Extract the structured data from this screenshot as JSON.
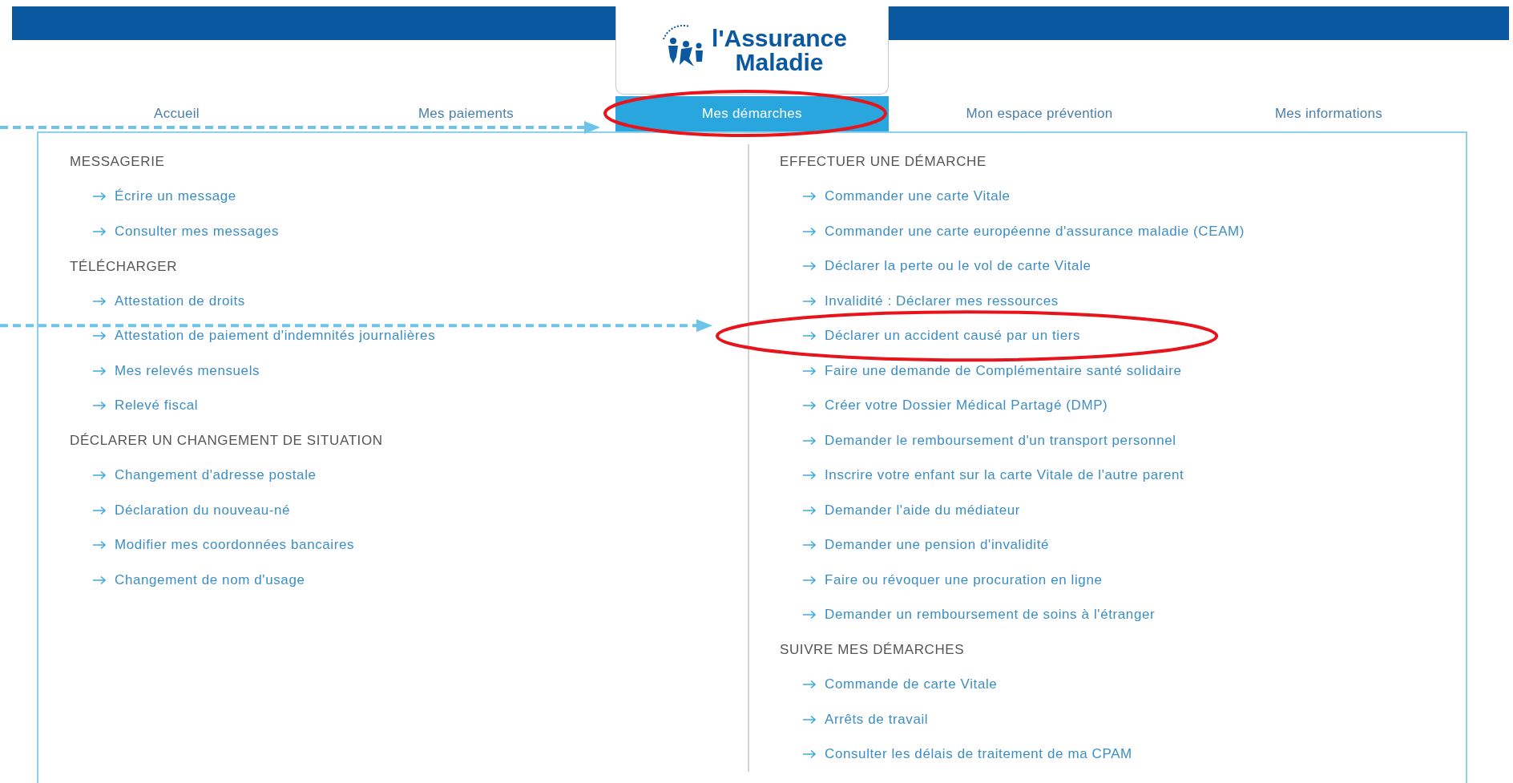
{
  "logo": {
    "lines": [
      "l'Assurance",
      "Maladie"
    ]
  },
  "tabs": [
    {
      "label": "Accueil",
      "selected": false,
      "annotated": false
    },
    {
      "label": "Mes paiements",
      "selected": false,
      "annotated": false
    },
    {
      "label": "Mes démarches",
      "selected": true,
      "annotated": true
    },
    {
      "label": "Mon espace prévention",
      "selected": false,
      "annotated": false
    },
    {
      "label": "Mes informations",
      "selected": false,
      "annotated": false
    }
  ],
  "columns": [
    {
      "sections": [
        {
          "heading": "MESSAGERIE",
          "items": [
            {
              "label": "Écrire un message",
              "annotated": false
            },
            {
              "label": "Consulter mes messages",
              "annotated": false
            }
          ]
        },
        {
          "heading": "TÉLÉCHARGER",
          "items": [
            {
              "label": "Attestation de droits",
              "annotated": false
            },
            {
              "label": "Attestation de paiement d'indemnités journalières",
              "annotated": false
            },
            {
              "label": "Mes relevés mensuels",
              "annotated": false
            },
            {
              "label": "Relevé fiscal",
              "annotated": false
            }
          ]
        },
        {
          "heading": "DÉCLARER UN CHANGEMENT DE SITUATION",
          "items": [
            {
              "label": "Changement d'adresse postale",
              "annotated": false
            },
            {
              "label": "Déclaration du nouveau-né",
              "annotated": false
            },
            {
              "label": "Modifier mes coordonnées bancaires",
              "annotated": false
            },
            {
              "label": "Changement de nom d'usage",
              "annotated": false
            }
          ]
        }
      ]
    },
    {
      "sections": [
        {
          "heading": "EFFECTUER UNE DÉMARCHE",
          "items": [
            {
              "label": "Commander une carte Vitale",
              "annotated": false
            },
            {
              "label": "Commander une carte européenne d'assurance maladie (CEAM)",
              "annotated": false
            },
            {
              "label": "Déclarer la perte ou le vol de carte Vitale",
              "annotated": false
            },
            {
              "label": "Invalidité : Déclarer mes ressources",
              "annotated": false
            },
            {
              "label": "Déclarer un accident causé par un tiers",
              "annotated": true
            },
            {
              "label": "Faire une demande de Complémentaire santé solidaire",
              "annotated": false
            },
            {
              "label": "Créer votre Dossier Médical Partagé (DMP)",
              "annotated": false
            },
            {
              "label": "Demander le remboursement d'un transport personnel",
              "annotated": false
            },
            {
              "label": "Inscrire votre enfant sur la carte Vitale de l'autre parent",
              "annotated": false
            },
            {
              "label": "Demander l'aide du médiateur",
              "annotated": false
            },
            {
              "label": "Demander une pension d'invalidité",
              "annotated": false
            },
            {
              "label": "Faire ou révoquer une procuration en ligne",
              "annotated": false
            },
            {
              "label": "Demander un remboursement de soins à l'étranger",
              "annotated": false
            }
          ]
        },
        {
          "heading": "SUIVRE MES DÉMARCHES",
          "items": [
            {
              "label": "Commande de carte Vitale",
              "annotated": false
            },
            {
              "label": "Arrêts de travail",
              "annotated": false
            },
            {
              "label": "Consulter les délais de traitement de ma CPAM",
              "annotated": false
            }
          ]
        }
      ]
    }
  ]
}
